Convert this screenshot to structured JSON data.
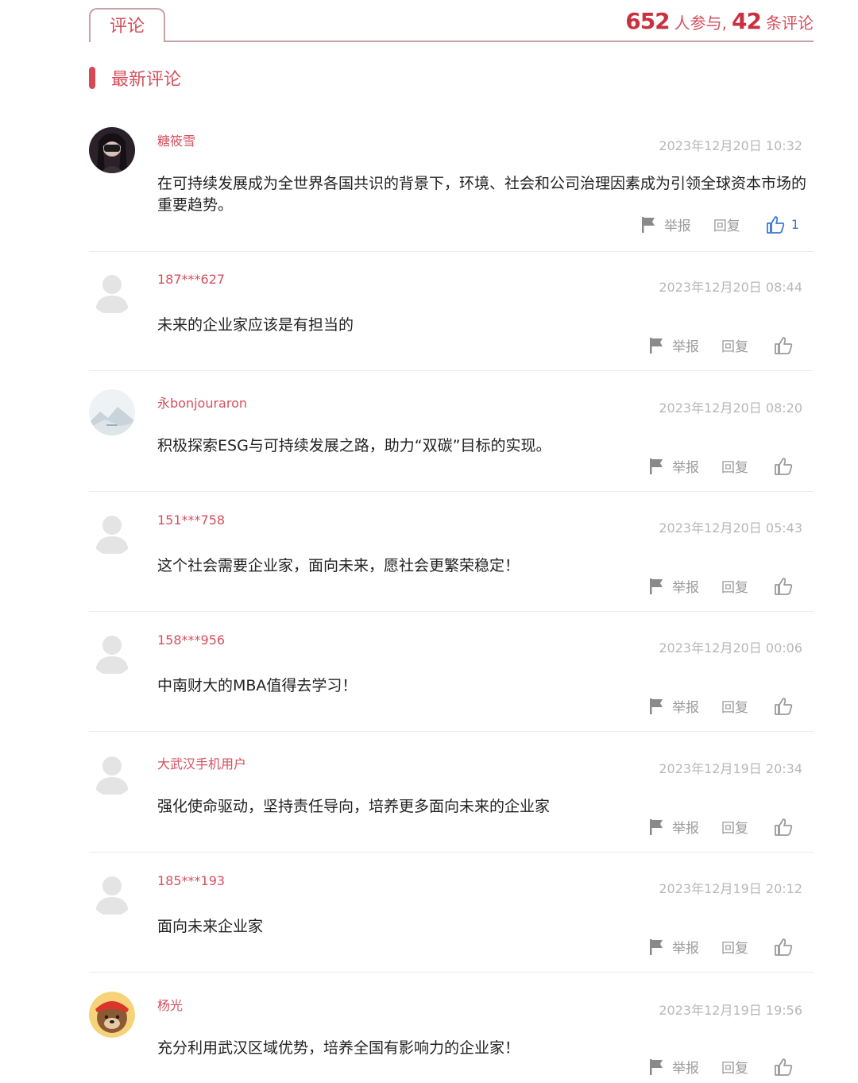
{
  "header": {
    "tab_label": "评论",
    "participants": "652",
    "participants_label": "人参与,",
    "comment_count": "42",
    "comment_count_label": "条评论"
  },
  "section": {
    "title": "最新评论"
  },
  "actions": {
    "report": "举报",
    "reply": "回复"
  },
  "comments": [
    {
      "user": "糖筱雪",
      "time": "2023年12月20日 10:32",
      "text": "在可持续发展成为全世界各国共识的背景下，环境、社会和公司治理因素成为引领全球资本市场的重要趋势。",
      "likes": "1",
      "avatar": "photo-dark"
    },
    {
      "user": "187***627",
      "time": "2023年12月20日 08:44",
      "text": "未来的企业家应该是有担当的",
      "likes": "",
      "avatar": "default"
    },
    {
      "user": "永bonjouraron",
      "time": "2023年12月20日 08:20",
      "text": "积极探索ESG与可持续发展之路，助力“双碳”目标的实现。",
      "likes": "",
      "avatar": "landscape"
    },
    {
      "user": "151***758",
      "time": "2023年12月20日 05:43",
      "text": "这个社会需要企业家，面向未来，愿社会更繁荣稳定！",
      "likes": "",
      "avatar": "default"
    },
    {
      "user": "158***956",
      "time": "2023年12月20日 00:06",
      "text": "中南财大的MBA值得去学习！",
      "likes": "",
      "avatar": "default"
    },
    {
      "user": "大武汉手机用户",
      "time": "2023年12月19日 20:34",
      "text": "强化使命驱动，坚持责任导向，培养更多面向未来的企业家",
      "likes": "",
      "avatar": "default"
    },
    {
      "user": "185***193",
      "time": "2023年12月19日 20:12",
      "text": "面向未来企业家",
      "likes": "",
      "avatar": "default"
    },
    {
      "user": "杨光",
      "time": "2023年12月19日 19:56",
      "text": "充分利用武汉区域优势，培养全国有影响力的企业家！",
      "likes": "",
      "avatar": "bear"
    }
  ],
  "colors": {
    "accent": "#d4505e",
    "number": "#c8313f",
    "like_active": "#3a78d8",
    "muted": "#9b9b9b"
  }
}
